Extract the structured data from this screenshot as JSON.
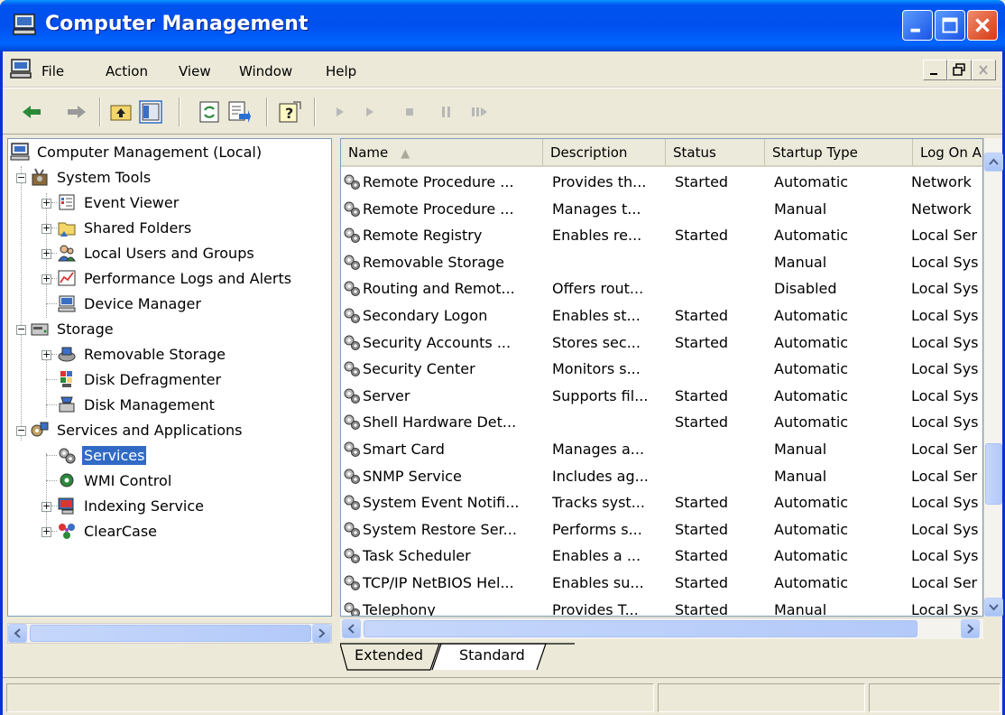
{
  "window": {
    "title": "Computer Management"
  },
  "menu": [
    "File",
    "Action",
    "View",
    "Window",
    "Help"
  ],
  "toolbar": {
    "buttons": [
      "back-icon",
      "forward-icon",
      "up-one-level-icon",
      "show-hide-tree-icon",
      "refresh-icon",
      "export-list-icon",
      "help-icon",
      "start-service-icon",
      "start-icon",
      "stop-icon",
      "pause-icon",
      "restart-icon"
    ]
  },
  "tree": {
    "root": "Computer Management (Local)",
    "system_tools": "System Tools",
    "event_viewer": "Event Viewer",
    "shared_folders": "Shared Folders",
    "local_users": "Local Users and Groups",
    "perf_logs": "Performance Logs and Alerts",
    "device_manager": "Device Manager",
    "storage": "Storage",
    "removable_storage": "Removable Storage",
    "disk_defrag": "Disk Defragmenter",
    "disk_mgmt": "Disk Management",
    "services_apps": "Services and Applications",
    "services": "Services",
    "wmi": "WMI Control",
    "indexing": "Indexing Service",
    "clearcase": "ClearCase"
  },
  "columns": [
    "Name",
    "Description",
    "Status",
    "Startup Type",
    "Log On A"
  ],
  "services": [
    {
      "name": "Remote Procedure ...",
      "description": "Provides th...",
      "status": "Started",
      "startup": "Automatic",
      "logon": "Network"
    },
    {
      "name": "Remote Procedure ...",
      "description": "Manages t...",
      "status": "",
      "startup": "Manual",
      "logon": "Network"
    },
    {
      "name": "Remote Registry",
      "description": "Enables re...",
      "status": "Started",
      "startup": "Automatic",
      "logon": "Local Ser"
    },
    {
      "name": "Removable Storage",
      "description": "",
      "status": "",
      "startup": "Manual",
      "logon": "Local Sys"
    },
    {
      "name": "Routing and Remot...",
      "description": "Offers rout...",
      "status": "",
      "startup": "Disabled",
      "logon": "Local Sys"
    },
    {
      "name": "Secondary Logon",
      "description": "Enables st...",
      "status": "Started",
      "startup": "Automatic",
      "logon": "Local Sys"
    },
    {
      "name": "Security Accounts ...",
      "description": "Stores sec...",
      "status": "Started",
      "startup": "Automatic",
      "logon": "Local Sys"
    },
    {
      "name": "Security Center",
      "description": "Monitors s...",
      "status": "",
      "startup": "Automatic",
      "logon": "Local Sys"
    },
    {
      "name": "Server",
      "description": "Supports fil...",
      "status": "Started",
      "startup": "Automatic",
      "logon": "Local Sys"
    },
    {
      "name": "Shell Hardware Det...",
      "description": "",
      "status": "Started",
      "startup": "Automatic",
      "logon": "Local Sys"
    },
    {
      "name": "Smart Card",
      "description": "Manages a...",
      "status": "",
      "startup": "Manual",
      "logon": "Local Ser"
    },
    {
      "name": "SNMP Service",
      "description": "Includes ag...",
      "status": "",
      "startup": "Manual",
      "logon": "Local Ser"
    },
    {
      "name": "System Event Notifi...",
      "description": "Tracks syst...",
      "status": "Started",
      "startup": "Automatic",
      "logon": "Local Sys"
    },
    {
      "name": "System Restore Ser...",
      "description": "Performs s...",
      "status": "Started",
      "startup": "Automatic",
      "logon": "Local Sys"
    },
    {
      "name": "Task Scheduler",
      "description": "Enables a ...",
      "status": "Started",
      "startup": "Automatic",
      "logon": "Local Sys"
    },
    {
      "name": "TCP/IP NetBIOS Hel...",
      "description": "Enables su...",
      "status": "Started",
      "startup": "Automatic",
      "logon": "Local Ser"
    },
    {
      "name": "Telephony",
      "description": "Provides T...",
      "status": "Started",
      "startup": "Manual",
      "logon": "Local Sys"
    }
  ],
  "tabs": [
    "Extended",
    "Standard"
  ],
  "colors": {
    "title_bar": "#0053ee",
    "selection": "#316ac5",
    "window_bg": "#ece9d8"
  }
}
